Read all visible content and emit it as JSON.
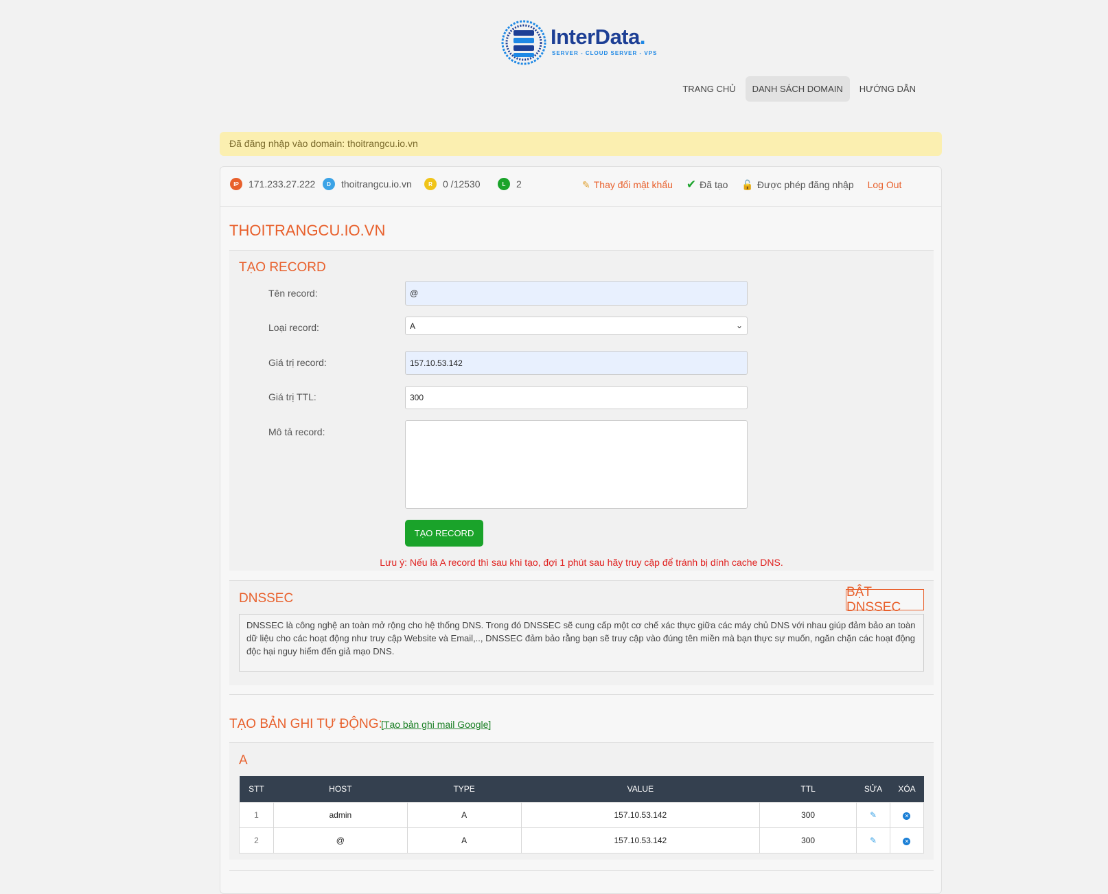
{
  "logo": {
    "brand": "InterData",
    "brand_dot": ".",
    "tagline": "SERVER - CLOUD SERVER - VPS"
  },
  "nav": {
    "home": "TRANG CHỦ",
    "domains": "DANH SÁCH DOMAIN",
    "guide": "HƯỚNG DẪN"
  },
  "alert": {
    "text": "Đã đăng nhập vào domain: thoitrangcu.io.vn"
  },
  "info": {
    "ip_badge": "IP",
    "ip": "171.233.27.222",
    "domain_badge": "D",
    "domain": "thoitrangcu.io.vn",
    "records_badge": "R",
    "records": "0 /12530",
    "level_badge": "L",
    "level": "2",
    "change_password": "Thay đổi mật khẩu",
    "created": "Đã tạo",
    "login_allowed": "Được phép đăng nhập",
    "logout": "Log Out"
  },
  "domain_title": "THOITRANGCU.IO.VN",
  "create_record": {
    "title": "TẠO RECORD",
    "name_label": "Tên record:",
    "name_value": "@",
    "type_label": "Loại record:",
    "type_value": "A",
    "value_label": "Giá trị record:",
    "value_value": "157.10.53.142",
    "ttl_label": "Giá trị TTL:",
    "ttl_value": "300",
    "desc_label": "Mô tả record:",
    "desc_value": "",
    "button": "TẠO RECORD",
    "note": "Lưu ý: Nếu là A record thì sau khi tạo, đợi 1 phút sau hãy truy cập để tránh bị dính cache DNS."
  },
  "dnssec": {
    "title": "DNSSEC",
    "button": "BẬT DNSSEC",
    "description": "DNSSEC là công nghệ an toàn mở rộng cho hệ thống DNS. Trong đó DNSSEC sẽ cung cấp một cơ chế xác thực giữa các máy chủ DNS với nhau giúp đảm bảo an toàn dữ liệu cho các hoạt động như truy cập Website và Email,.., DNSSEC đảm bảo rằng bạn sẽ truy cập vào đúng tên miền mà bạn thực sự muốn, ngăn chặn các hoạt động độc hại nguy hiểm đến giả mạo DNS."
  },
  "auto": {
    "title": "TẠO BẢN GHI TỰ ĐỘNG:",
    "link": "[Tạo bản ghi mail Google]"
  },
  "records": {
    "section_title": "A",
    "headers": {
      "stt": "STT",
      "host": "HOST",
      "type": "TYPE",
      "value": "VALUE",
      "ttl": "TTL",
      "edit": "SỬA",
      "delete": "XÓA"
    },
    "rows": [
      {
        "stt": "1",
        "host": "admin",
        "type": "A",
        "value": "157.10.53.142",
        "ttl": "300"
      },
      {
        "stt": "2",
        "host": "@",
        "type": "A",
        "value": "157.10.53.142",
        "ttl": "300"
      }
    ]
  },
  "icons": {
    "edit": "edit-icon",
    "delete": "delete-icon",
    "pencil": "pencil-icon",
    "check": "checkmark-icon",
    "lock": "unlock-icon"
  },
  "colors": {
    "accent": "#e8602c",
    "success": "#1aa32a",
    "table_header": "#34404f",
    "alert_bg": "#fbefb0",
    "note": "#e0201e"
  }
}
